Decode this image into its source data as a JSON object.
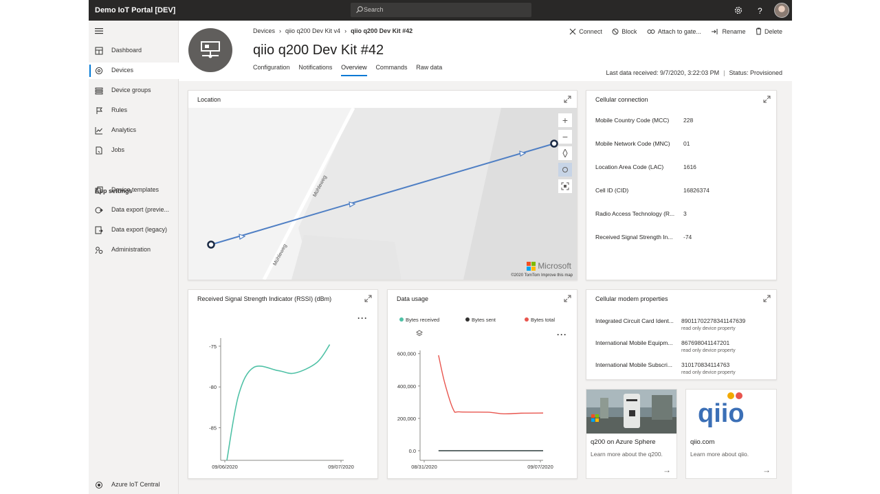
{
  "app": {
    "title": "Demo IoT Portal [DEV]"
  },
  "search": {
    "placeholder": "Search"
  },
  "topbar": {
    "icons": [
      "gear-icon",
      "help-icon",
      "avatar"
    ]
  },
  "sidebar": {
    "items": [
      {
        "label": "Dashboard",
        "icon": "dashboard-icon"
      },
      {
        "label": "Devices",
        "icon": "devices-icon",
        "active": true
      },
      {
        "label": "Device groups",
        "icon": "device-groups-icon"
      },
      {
        "label": "Rules",
        "icon": "rules-icon"
      },
      {
        "label": "Analytics",
        "icon": "analytics-icon"
      },
      {
        "label": "Jobs",
        "icon": "jobs-icon"
      }
    ],
    "section_header": "App settings",
    "settings_items": [
      {
        "label": "Device templates",
        "icon": "templates-icon"
      },
      {
        "label": "Data export (previe...",
        "icon": "data-export-icon"
      },
      {
        "label": "Data export (legacy)",
        "icon": "data-export-legacy-icon"
      },
      {
        "label": "Administration",
        "icon": "administration-icon"
      }
    ],
    "footer": "Azure IoT Central"
  },
  "breadcrumb": {
    "items": [
      "Devices",
      "qiio q200 Dev Kit v4",
      "qiio q200 Dev Kit #42"
    ]
  },
  "device": {
    "title": "qiio q200 Dev Kit #42",
    "tabs": [
      "Configuration",
      "Notifications",
      "Overview",
      "Commands",
      "Raw data"
    ],
    "active_tab": "Overview",
    "last_data": "Last data received: 9/7/2020, 3:22:03 PM",
    "status": "Status: Provisioned"
  },
  "actions": [
    "Connect",
    "Block",
    "Attach to gate...",
    "Rename",
    "Delete"
  ],
  "location": {
    "title": "Location",
    "street_1": "Mühleweg",
    "street_2": "Mühleweg",
    "logo": "Microsoft",
    "attribution": "©2020 TomTom  Improve this map"
  },
  "cellular": {
    "title": "Cellular connection",
    "rows": [
      {
        "key": "Mobile Country Code (MCC)",
        "value": "228"
      },
      {
        "key": "Mobile Network Code (MNC)",
        "value": "01"
      },
      {
        "key": "Location Area Code (LAC)",
        "value": "1616"
      },
      {
        "key": "Cell ID (CID)",
        "value": "16826374"
      },
      {
        "key": "Radio Access Technology (R...",
        "value": "3"
      },
      {
        "key": "Received Signal Strength In...",
        "value": "-74"
      }
    ]
  },
  "rssi": {
    "title": "Received Signal Strength Indicator (RSSI) (dBm)"
  },
  "data_usage": {
    "title": "Data usage",
    "colors": {
      "received": "#4fc1a6",
      "sent": "#323130",
      "total": "#e8554e"
    }
  },
  "modem": {
    "title": "Cellular modem properties",
    "rows": [
      {
        "key": "Integrated Circuit Card Ident...",
        "value": "89011702278341147639",
        "note": "read only device property"
      },
      {
        "key": "International Mobile Equipm...",
        "value": "867698041147201",
        "note": "read only device property"
      },
      {
        "key": "International Mobile Subscri...",
        "value": "310170834114763",
        "note": "read only device property"
      }
    ]
  },
  "tiles": [
    {
      "title": "q200 on Azure Sphere",
      "desc": "Learn more about the q200."
    },
    {
      "title": "qiio.com",
      "desc": "Learn more about qiio.",
      "logo": "qiio"
    }
  ],
  "chart_data": [
    {
      "type": "line",
      "title": "Received Signal Strength Indicator (RSSI) (dBm)",
      "x_ticks": [
        "09/06/2020",
        "09/07/2020"
      ],
      "y_ticks": [
        -75,
        -80,
        -85
      ],
      "ylim": [
        -89,
        -74
      ],
      "series": [
        {
          "values": [
            {
              "x": 0.0,
              "y": -89
            },
            {
              "x": 0.1,
              "y": -81
            },
            {
              "x": 0.23,
              "y": -77.6
            },
            {
              "x": 0.44,
              "y": -78
            },
            {
              "x": 0.58,
              "y": -78.3
            },
            {
              "x": 0.77,
              "y": -77
            },
            {
              "x": 0.88,
              "y": -74.8
            }
          ]
        }
      ]
    },
    {
      "type": "line",
      "title": "Data usage",
      "x_ticks": [
        "08/31/2020",
        "09/07/2020"
      ],
      "y_ticks": [
        600000,
        400000,
        200000,
        0
      ],
      "y_tick_labels": [
        "600,000",
        "400,000",
        "200,000",
        "0.0"
      ],
      "ylim": [
        0,
        620000
      ],
      "series": [
        {
          "name": "Bytes received",
          "values": []
        },
        {
          "name": "Bytes sent",
          "values": [
            {
              "x": 0.15,
              "y": 0
            },
            {
              "x": 1.0,
              "y": 0
            }
          ]
        },
        {
          "name": "Bytes total",
          "values": [
            {
              "x": 0.15,
              "y": 590000
            },
            {
              "x": 0.2,
              "y": 420000
            },
            {
              "x": 0.27,
              "y": 255000
            },
            {
              "x": 0.32,
              "y": 240000
            },
            {
              "x": 0.55,
              "y": 238000
            },
            {
              "x": 0.68,
              "y": 228000
            },
            {
              "x": 0.82,
              "y": 232000
            },
            {
              "x": 1.0,
              "y": 233000
            }
          ]
        }
      ]
    }
  ]
}
